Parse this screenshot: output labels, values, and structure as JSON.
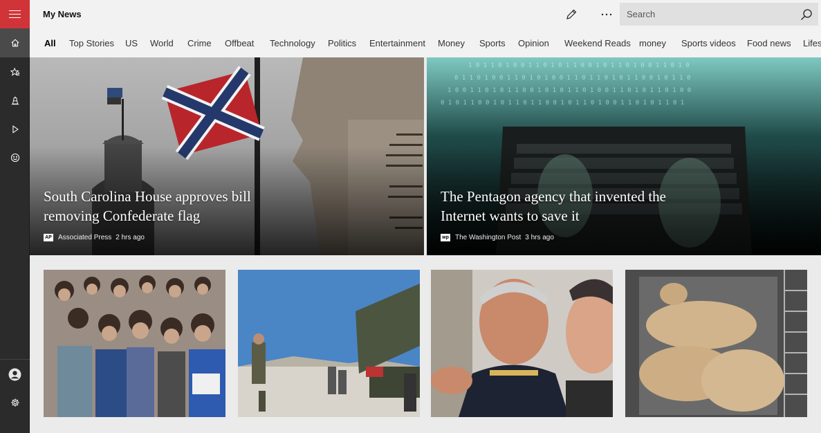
{
  "app": {
    "title": "My News"
  },
  "search": {
    "placeholder": "Search"
  },
  "rail": {
    "items": [
      "menu-icon",
      "home-icon",
      "favorites-icon",
      "local-icon",
      "video-icon",
      "emoji-icon",
      "account-icon",
      "settings-icon"
    ]
  },
  "tabs": [
    {
      "label": "All",
      "active": true
    },
    {
      "label": "Top Stories"
    },
    {
      "label": "US"
    },
    {
      "label": "World"
    },
    {
      "label": "Crime"
    },
    {
      "label": "Offbeat"
    },
    {
      "label": "Technology"
    },
    {
      "label": "Politics"
    },
    {
      "label": "Entertainment"
    },
    {
      "label": "Money"
    },
    {
      "label": "Sports"
    },
    {
      "label": "Opinion"
    },
    {
      "label": "Weekend Reads"
    },
    {
      "label": "money"
    },
    {
      "label": "Sports videos"
    },
    {
      "label": "Food news"
    },
    {
      "label": "Lifestyle"
    }
  ],
  "hero": [
    {
      "headline": "South Carolina House approves bill removing Confederate flag",
      "source_logo": "AP",
      "source": "Associated Press",
      "time": "2 hrs ago"
    },
    {
      "headline": "The Pentagon agency that invented the Internet wants to save it",
      "source_logo": "wp",
      "source": "The Washington Post",
      "time": "3 hrs ago"
    }
  ],
  "colors": {
    "accent": "#d13438",
    "rail": "#2b2b2b",
    "topbar": "#f2f2f2"
  }
}
